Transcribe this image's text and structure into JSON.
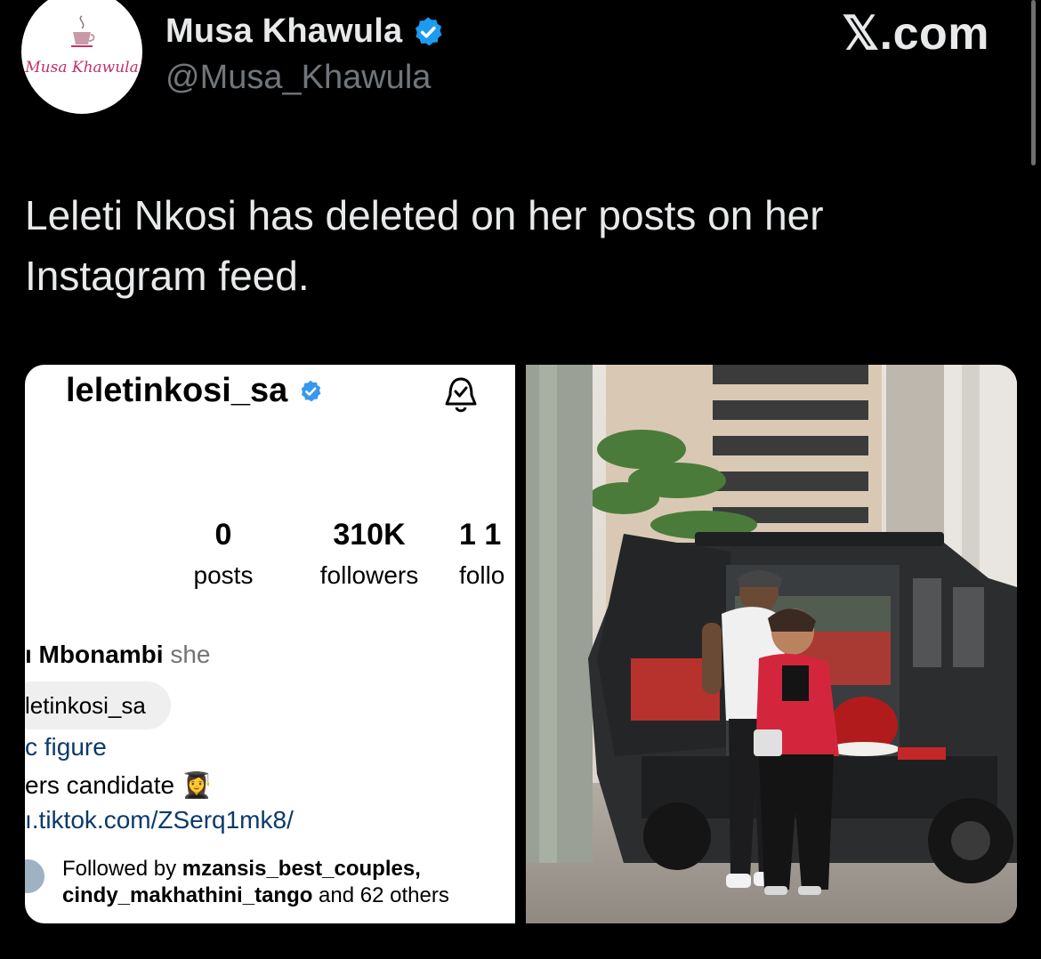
{
  "author": {
    "display_name": "Musa Khawula",
    "handle": "@Musa_Khawula",
    "verified": true,
    "avatar_logo_text": "Musa Khawula",
    "verified_color": "#1d9bf0"
  },
  "brand": {
    "site": "𝕏.com"
  },
  "tweet": {
    "line1": "Leleti Nkosi has deleted on her posts on her",
    "line2": "Instagram feed."
  },
  "instagram": {
    "username": "leletinkosi_sa",
    "verified": true,
    "stats": [
      {
        "num": "0",
        "label": "posts"
      },
      {
        "num": "310K",
        "label": "followers"
      },
      {
        "num": "1 1",
        "label": "follo"
      }
    ],
    "bio_name": "ı Mbonambi",
    "pronoun": "she",
    "threads_handle": "letinkosi_sa",
    "category": "c figure",
    "candidate": "ers candidate 👩‍🎓",
    "link": "ı.tiktok.com/ZSerq1mk8/",
    "followed_by_prefix": "Followed by ",
    "followed_by_user1": "mzansis_best_couples,",
    "followed_by_user2": "cindy_makhathini_tango",
    "followed_by_suffix": " and 62 others"
  },
  "photo": {
    "description_icon": "couple-with-suv-photo"
  }
}
